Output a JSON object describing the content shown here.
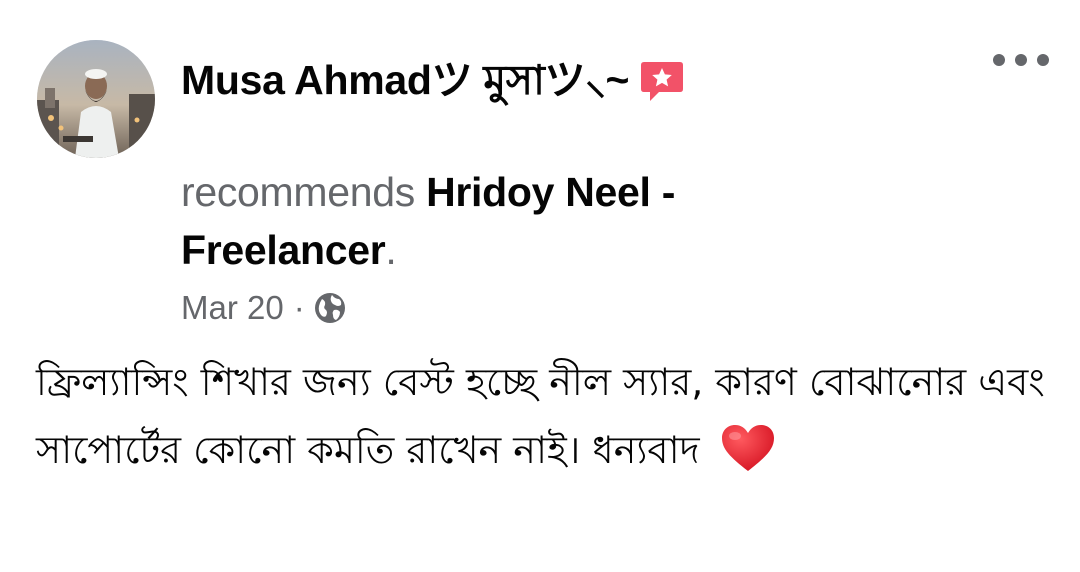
{
  "post": {
    "author": "Musa Ahmadツ মুসাツ⸜~",
    "recommends_word": "recommends",
    "page_name": "Hridoy Neel - Freelancer",
    "period": ".",
    "date": "Mar 20",
    "dot": "·",
    "body_text": "ফ্রিল্যান্সিং শিখার জন্য বেস্ট হচ্ছে নীল স্যার, কারণ বোঝানোর এবং সাপোর্টের কোনো কমতি রাখেন নাই। ধন্যবাদ",
    "privacy_icon": "globe-icon",
    "badge_icon": "recommendation-star-icon",
    "reaction_emoji": "heart-emoji"
  },
  "colors": {
    "text_primary": "#050505",
    "text_secondary": "#65676b",
    "badge_pink": "#f25268",
    "heart_red": "#e0162b"
  }
}
